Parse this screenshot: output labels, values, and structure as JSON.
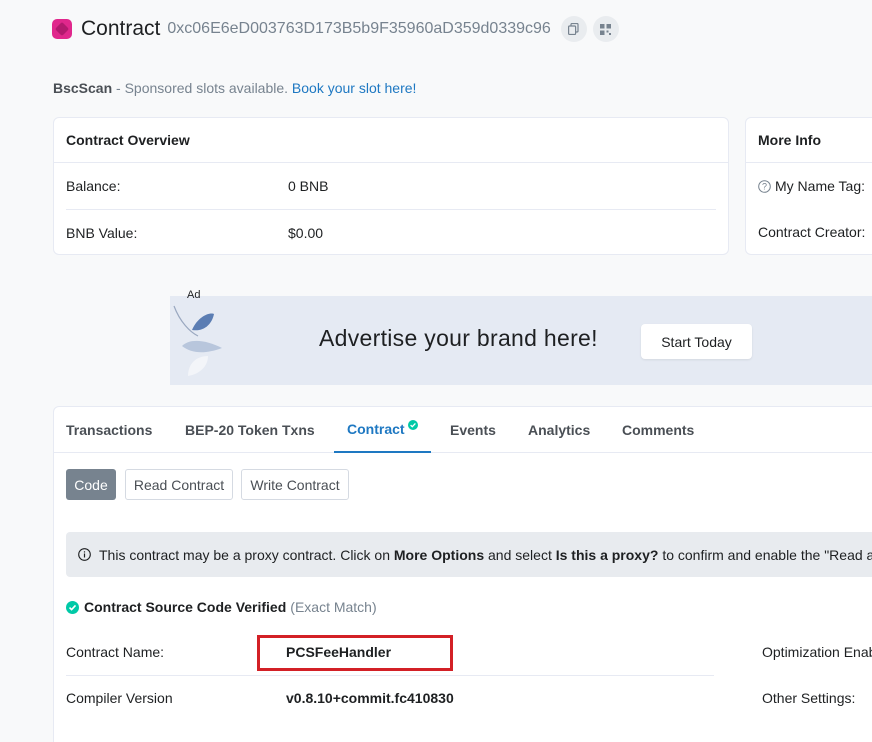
{
  "header": {
    "title": "Contract",
    "address": "0xc06E6eD003763D173B5b9F35960aD359d0339c96"
  },
  "sponsor": {
    "brand": "BscScan",
    "text": " - Sponsored slots available. ",
    "link": "Book your slot here!"
  },
  "overview": {
    "title": "Contract Overview",
    "balance_label": "Balance:",
    "balance_value": "0 BNB",
    "bnb_value_label": "BNB Value:",
    "bnb_value_value": "$0.00"
  },
  "more_info": {
    "title": "More Info",
    "name_tag_label": "My Name Tag:",
    "creator_label": "Contract Creator:"
  },
  "ad": {
    "tag": "Ad",
    "text": "Advertise your brand here!",
    "button": "Start Today"
  },
  "tabs": [
    "Transactions",
    "BEP-20 Token Txns",
    "Contract",
    "Events",
    "Analytics",
    "Comments"
  ],
  "sub_buttons": {
    "code": "Code",
    "read": "Read Contract",
    "write": "Write Contract"
  },
  "alert": {
    "part1": "This contract may be a proxy contract. Click on ",
    "bold1": "More Options",
    "part2": " and select ",
    "bold2": "Is this a proxy?",
    "part3": " to confirm and enable the \"Read a"
  },
  "verified": {
    "title": "Contract Source Code Verified",
    "note": "(Exact Match)"
  },
  "details": {
    "name_label": "Contract Name:",
    "name_value": "PCSFeeHandler",
    "compiler_label": "Compiler Version",
    "compiler_value": "v0.8.10+commit.fc410830",
    "optimization_label": "Optimization Enab",
    "other_label": "Other Settings:"
  },
  "colors": {
    "accent": "#1e78c2",
    "success": "#00c9a7",
    "highlight_box": "#d32026"
  }
}
